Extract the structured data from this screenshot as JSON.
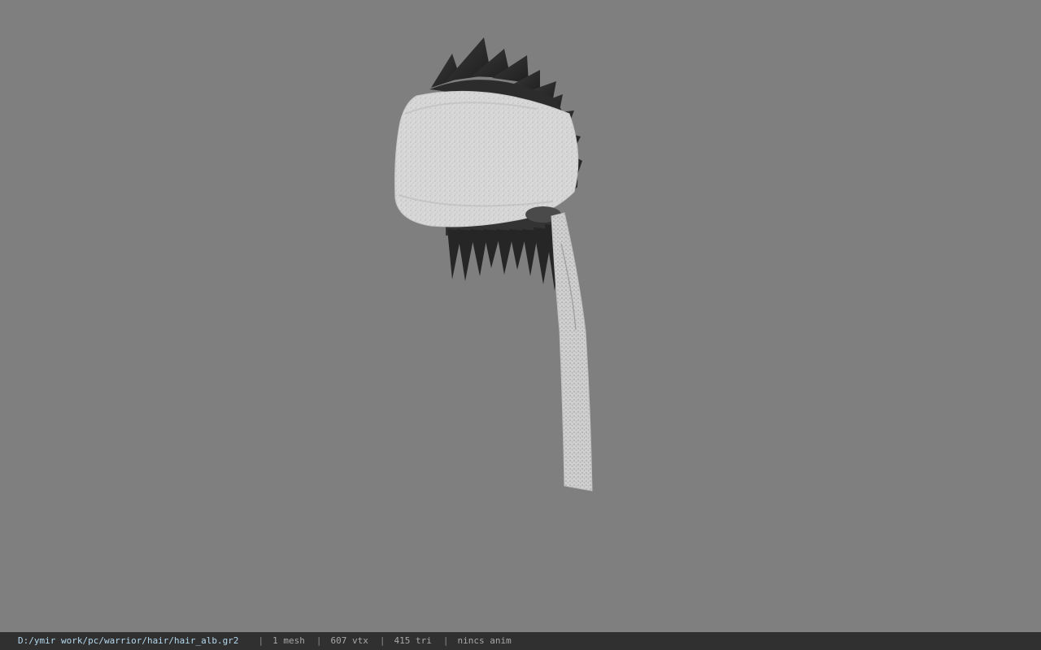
{
  "viewport": {
    "background_color": "#7f7f7f",
    "model_name": "hair-with-headband-icon"
  },
  "status_bar": {
    "file_path": "D:/ymir work/pc/warrior/hair/hair_alb.gr2",
    "separator": "|",
    "mesh_count": "1 mesh",
    "vertex_count": "607 vtx",
    "triangle_count": "415 tri",
    "animation": "nincs anim"
  }
}
